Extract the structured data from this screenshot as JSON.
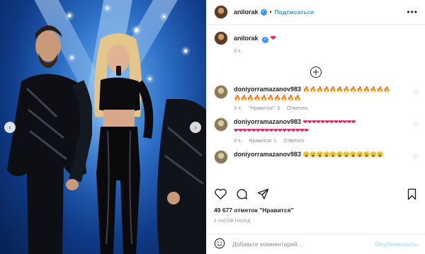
{
  "post": {
    "username": "anilorak",
    "follow_label": "Подписаться",
    "more_label": "•••",
    "caption_emoji": "❤",
    "caption_time": "3 ч."
  },
  "comments": [
    {
      "username": "doniyorramazanov983",
      "emoji_line1": "🔥🔥🔥🔥🔥🔥🔥🔥🔥🔥🔥🔥🔥",
      "emoji_line2": "🔥🔥🔥🔥🔥🔥🔥🔥🔥🔥",
      "emoji_class": "fire",
      "time": "3 ч.",
      "likes": "\"Нравится\": 3",
      "reply": "Ответить"
    },
    {
      "username": "doniyorramazanov983",
      "emoji_line1": "❤❤❤❤❤❤❤❤❤❤❤❤",
      "emoji_line2": "❤❤❤❤❤❤❤❤❤❤❤❤❤❤❤❤❤",
      "emoji_class": "heart",
      "time": "3 ч.",
      "likes": "Нравится: 1",
      "reply": "Ответить"
    },
    {
      "username": "doniyorramazanov983",
      "emoji_line1": "😮😮😮😮😮😮😮😮😮😮😮😮",
      "emoji_line2": "",
      "emoji_class": "sad",
      "time": "",
      "likes": "",
      "reply": ""
    }
  ],
  "footer": {
    "likes_count": "49 677 отметок \"Нравится\"",
    "time_ago": "3 ЧАСОВ НАЗАД",
    "comment_placeholder": "Добавьте комментарий...",
    "publish_label": "Опубликовать"
  },
  "icons": {
    "heart": "heart-icon",
    "comment": "comment-icon",
    "share": "share-icon",
    "save": "bookmark-icon",
    "emoji": "emoji-icon",
    "load_more": "plus-circle-icon"
  },
  "colors": {
    "accent": "#3897f0",
    "heart": "#e0245e",
    "muted": "#8e8e8e"
  }
}
